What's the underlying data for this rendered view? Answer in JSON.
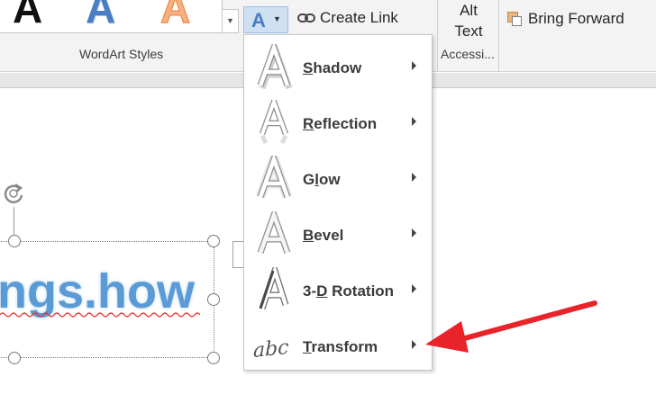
{
  "ribbon": {
    "group_label": "WordArt Styles",
    "create_link_label": "Create Link",
    "alt_text_line1": "Alt",
    "alt_text_line2": "Text",
    "accessibility_label": "Accessi...",
    "bring_forward_label": "Bring Forward",
    "text_effects_letter": "A",
    "wordart_samples": [
      "A",
      "A",
      "A"
    ]
  },
  "menu": {
    "items": [
      {
        "pre": "",
        "key": "S",
        "post": "hadow",
        "icon": "shadow-icon"
      },
      {
        "pre": "",
        "key": "R",
        "post": "eflection",
        "icon": "reflection-icon"
      },
      {
        "pre": "G",
        "key": "l",
        "post": "ow",
        "icon": "glow-icon"
      },
      {
        "pre": "",
        "key": "B",
        "post": "evel",
        "icon": "bevel-icon"
      },
      {
        "pre": "3-",
        "key": "D",
        "post": " Rotation",
        "icon": "3d-rotation-icon"
      },
      {
        "pre": "",
        "key": "T",
        "post": "ransform",
        "icon": "transform-icon"
      }
    ]
  },
  "slide": {
    "wordart_text": "ngs.how"
  },
  "colors": {
    "accent": "#5b9bd5",
    "annotation_arrow": "#e8232a"
  }
}
